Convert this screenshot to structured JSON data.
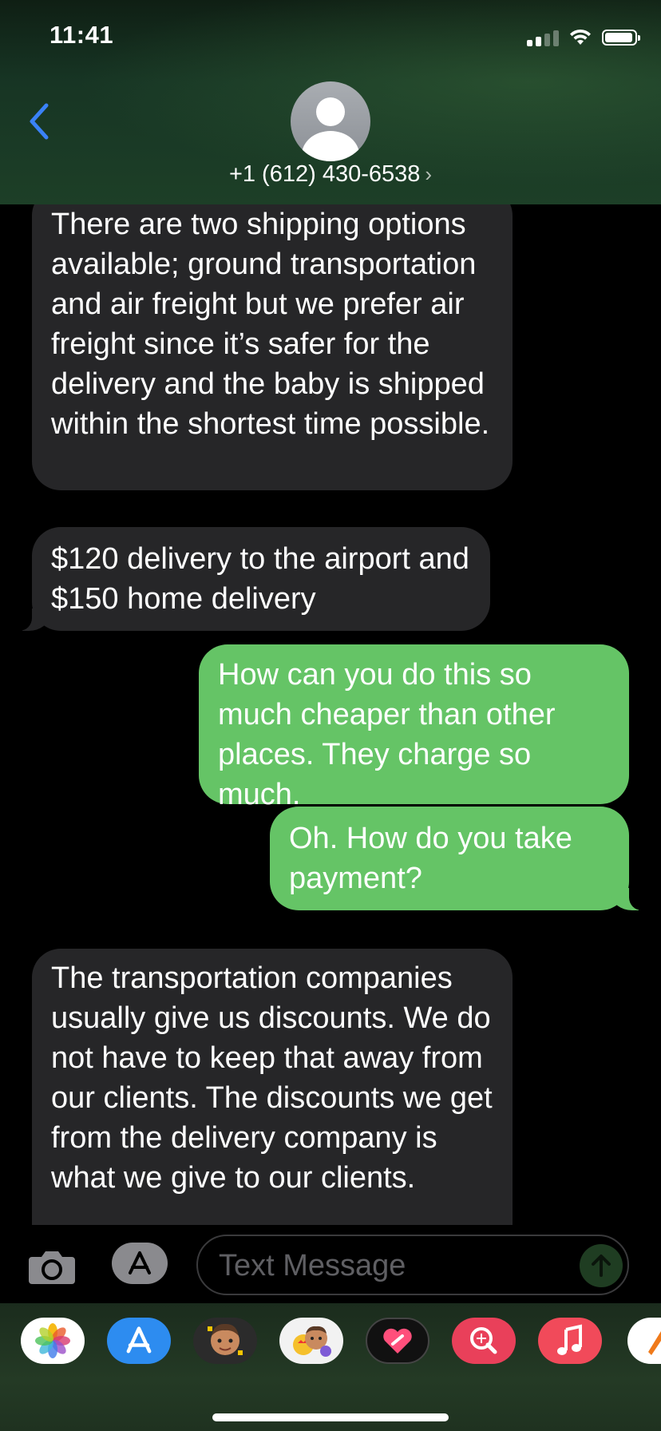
{
  "status_bar": {
    "time": "11:41"
  },
  "header": {
    "contact": "+1 (612) 430-6538",
    "chevron": "›"
  },
  "messages": [
    {
      "direction": "incoming",
      "text": "There are two shipping options available; ground transportation and air freight but we prefer air freight since it’s safer for the delivery and the baby is shipped within the shortest time possible."
    },
    {
      "direction": "incoming",
      "text": "$120 delivery to the airport and $150 home delivery"
    },
    {
      "direction": "outgoing",
      "text": "How can you do this so much cheaper than other places. They charge so much."
    },
    {
      "direction": "outgoing",
      "text": "Oh. How do you take payment?"
    },
    {
      "direction": "incoming",
      "text": "The transportation companies usually give us discounts. We do not have to keep that away from our clients. The discounts we get from the delivery company is what we give to our clients."
    }
  ],
  "input": {
    "placeholder": "Text Message"
  },
  "app_drawer": {
    "apps": [
      "photos-app-icon",
      "app-store-app-icon",
      "memoji-app-icon",
      "animoji-app-icon",
      "digital-touch-app-icon",
      "image-search-app-icon",
      "music-app-icon",
      "more-app-icon"
    ]
  },
  "colors": {
    "incoming_bubble": "#262628",
    "outgoing_bubble": "#65c466",
    "accent_blue": "#3a82f7"
  }
}
